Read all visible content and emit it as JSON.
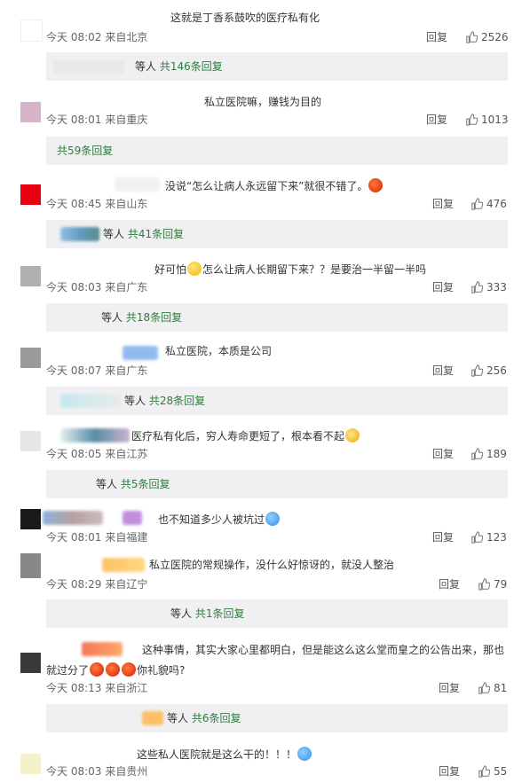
{
  "comments": [
    {
      "text": "这就是丁香系鼓吹的医疗私有化",
      "time": "今天 08:02",
      "loc": "来自北京",
      "reply": "回复",
      "likes": "2526",
      "sub_prefix": "等人",
      "sub_count": "共146条回复"
    },
    {
      "text": "私立医院嘛，赚钱为目的",
      "time": "今天 08:01",
      "loc": "来自重庆",
      "reply": "回复",
      "likes": "1013",
      "sub_prefix": "",
      "sub_count": "共59条回复"
    },
    {
      "text": "没说“怎么让病人永远留下来”就很不错了。",
      "time": "今天 08:45",
      "loc": "来自山东",
      "reply": "回复",
      "likes": "476",
      "sub_prefix": "等人",
      "sub_count": "共41条回复"
    },
    {
      "text_a": "好可怕",
      "text_b": "怎么让病人长期留下来？？是要治一半留一半吗",
      "time": "今天 08:03",
      "loc": "来自广东",
      "reply": "回复",
      "likes": "333",
      "sub_prefix": "等人",
      "sub_count": "共18条回复"
    },
    {
      "text": "私立医院，本质是公司",
      "time": "今天 08:07",
      "loc": "来自广东",
      "reply": "回复",
      "likes": "256",
      "sub_prefix": "等人",
      "sub_count": "共28条回复"
    },
    {
      "text": "医疗私有化后，穷人寿命更短了，根本看不起",
      "time": "今天 08:05",
      "loc": "来自江苏",
      "reply": "回复",
      "likes": "189",
      "sub_prefix": "等人",
      "sub_count": "共5条回复"
    },
    {
      "text": "也不知道多少人被坑过",
      "time": "今天 08:01",
      "loc": "来自福建",
      "reply": "回复",
      "likes": "123"
    },
    {
      "text": "私立医院的常规操作，没什么好惊讶的，就没人整治",
      "time": "今天 08:29",
      "loc": "来自辽宁",
      "reply": "回复",
      "likes": "79",
      "sub_prefix": "等人",
      "sub_count": "共1条回复"
    },
    {
      "text_line1": "这种事情，其实大家心里都明白，但是能这么这么堂而皇之的公告出来，那也",
      "text_line2a": "就过分了",
      "text_line2b": "你礼貌吗?",
      "time": "今天 08:13",
      "loc": "来自浙江",
      "reply": "回复",
      "likes": "81",
      "sub_prefix": "等人",
      "sub_count": "共6条回复"
    },
    {
      "text": "这些私人医院就是这么干的！！！",
      "time": "今天 08:03",
      "loc": "来自贵州",
      "reply": "回复",
      "likes": "55"
    }
  ],
  "colors": {
    "reply_count": "#2a7f3a",
    "sub_bg": "#f0f0f2"
  }
}
